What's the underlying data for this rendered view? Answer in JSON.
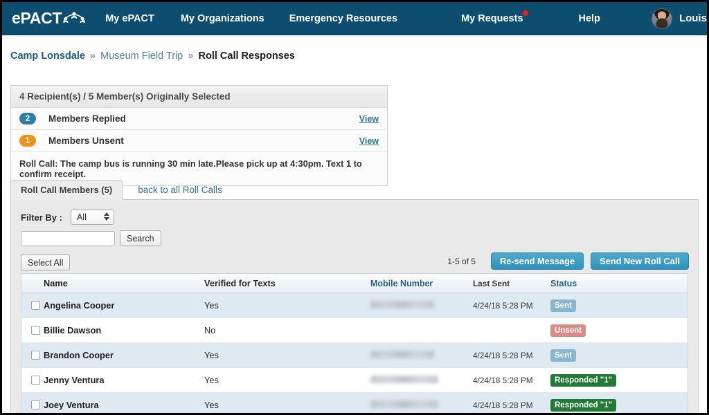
{
  "navbar": {
    "logo_text": "ePACT",
    "logo_icon": "people-arc-icon",
    "links": [
      {
        "label": "My ePACT",
        "name": "nav-my-epact"
      },
      {
        "label": "My Organizations",
        "name": "nav-my-organizations"
      },
      {
        "label": "Emergency Resources",
        "name": "nav-emergency-resources"
      },
      {
        "label": "My Requests",
        "name": "nav-my-requests",
        "badge_dot": true
      },
      {
        "label": "Help",
        "name": "nav-help"
      }
    ],
    "user_name": "Louis",
    "brand_color": "#0d4d70",
    "notification_color": "#f01c1c"
  },
  "breadcrumb": {
    "org": "Camp Lonsdale",
    "sep": "»",
    "event": "Museum Field Trip",
    "current": "Roll Call Responses"
  },
  "summary": {
    "header": "4 Recipient(s) / 5 Member(s) Originally Selected",
    "rows": [
      {
        "count": "2",
        "label": "Members Replied",
        "action": "View",
        "color": "#2f7cab"
      },
      {
        "count": "1",
        "label": "Members Unsent",
        "action": "View",
        "color": "#f0901c"
      }
    ],
    "message": "Roll Call: The camp bus is running 30 min late.Please pick up at 4:30pm. Text 1 to confirm receipt."
  },
  "tabs": {
    "active_label": "Roll Call Members (5)",
    "back_link": "back to all Roll Calls"
  },
  "filter": {
    "label": "Filter By :",
    "selected": "All",
    "options": [
      "All"
    ],
    "search_value": "",
    "search_placeholder": "",
    "search_button": "Search",
    "select_all_button": "Select All"
  },
  "actions": {
    "count_text": "1-5 of 5",
    "resend_button": "Re-send Message",
    "send_new_button": "Send New Roll Call"
  },
  "table": {
    "columns": [
      "Name",
      "Verified for Texts",
      "Mobile Number",
      "Last Sent",
      "Status"
    ],
    "rows": [
      {
        "name": "Angelina Cooper",
        "verified": "Yes",
        "mobile": "",
        "mobile_redacted": true,
        "last_sent": "4/24/18 5:28 PM",
        "status": "Sent",
        "status_color": "#87b4ce"
      },
      {
        "name": "Billie Dawson",
        "verified": "No",
        "mobile": "",
        "mobile_redacted": false,
        "last_sent": "",
        "status": "Unsent",
        "status_color": "#d98b86"
      },
      {
        "name": "Brandon Cooper",
        "verified": "Yes",
        "mobile": "",
        "mobile_redacted": true,
        "last_sent": "4/24/18 5:28 PM",
        "status": "Sent",
        "status_color": "#87b4ce"
      },
      {
        "name": "Jenny Ventura",
        "verified": "Yes",
        "mobile": "",
        "mobile_redacted": true,
        "last_sent": "4/24/18 5:28 PM",
        "status": "Responded \"1\"",
        "status_color": "#1f7a33"
      },
      {
        "name": "Joey Ventura",
        "verified": "Yes",
        "mobile": "",
        "mobile_redacted": true,
        "last_sent": "4/24/18 5:28 PM",
        "status": "Responded \"1\"",
        "status_color": "#1f7a33"
      }
    ]
  }
}
